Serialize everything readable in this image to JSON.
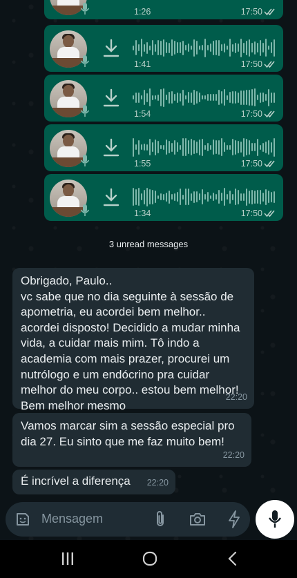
{
  "voice_notes": [
    {
      "duration": "1:26",
      "time": "17:50"
    },
    {
      "duration": "1:41",
      "time": "17:50"
    },
    {
      "duration": "1:54",
      "time": "17:50"
    },
    {
      "duration": "1:55",
      "time": "17:50"
    },
    {
      "duration": "1:34",
      "time": "17:50"
    }
  ],
  "unread_label": "3 unread messages",
  "messages": [
    {
      "text": "Obrigado, Paulo..\nvc sabe que no dia seguinte à sessão de apometria, eu acordei bem melhor.. acordei disposto! Decidido a mudar minha vida, a cuidar mais mim. Tô indo a academia com mais prazer, procurei um nutrólogo e um endócrino pra cuidar melhor do meu corpo.. estou bem melhor! Bem melhor mesmo",
      "time": "22:20"
    },
    {
      "text": "Vamos marcar sim a sessão especial pro dia 27. Eu sinto que me faz muito bem!",
      "time": "22:20"
    },
    {
      "text": "É incrível a diferença",
      "time": "22:20"
    }
  ],
  "composer": {
    "placeholder": "Mensagem"
  },
  "colors": {
    "outgoing_bubble": "#005c4b",
    "incoming_bubble": "#202c33",
    "background": "#0b141a"
  },
  "icons": [
    "download-icon",
    "mic-icon",
    "double-check-icon",
    "sticker-icon",
    "attach-icon",
    "camera-icon",
    "bolt-icon",
    "recents-icon",
    "home-icon",
    "back-icon"
  ]
}
